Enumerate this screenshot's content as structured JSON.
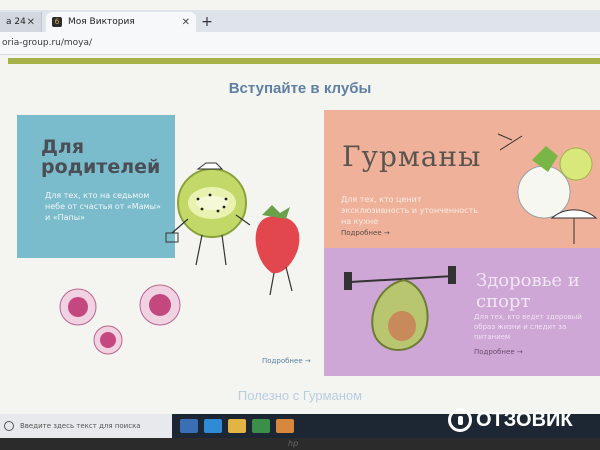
{
  "browser": {
    "tabs": [
      {
        "label": "а 24",
        "active": false
      },
      {
        "label": "Моя Виктория",
        "active": true
      }
    ],
    "new_tab": "+",
    "close": "✕",
    "favicon_text": "б",
    "url": "oria-group.ru/moya/"
  },
  "page": {
    "title": "Вступайте в клубы",
    "cards": {
      "parents": {
        "title": "Для родителей",
        "description": "Для тех, кто на седьмом небе от счастья от «Мамы» и «Папы»"
      },
      "gourmets": {
        "title": "Гурманы",
        "description": "Для тех, кто ценит эксклюзивность и утонченность на кухне",
        "more": "Подробнее →"
      },
      "health": {
        "title": "Здоровье и спорт",
        "description": "Для тех, кто ведет здоровый образ жизни и следит за питанием",
        "more": "Подробнее →"
      }
    },
    "more_parents": "Подробнее →",
    "bottom_title": "Полезно с Гурманом"
  },
  "taskbar": {
    "search_placeholder": "Введите здесь текст для поиска"
  },
  "watermark": "ОТЗОВИК",
  "laptop_brand": "hp",
  "colors": {
    "blue_card": "#7bbccc",
    "orange_card": "#efb199",
    "purple_card": "#cfa7d6",
    "title_blue": "#5f7fa3",
    "accent_green": "#a8b24b"
  }
}
